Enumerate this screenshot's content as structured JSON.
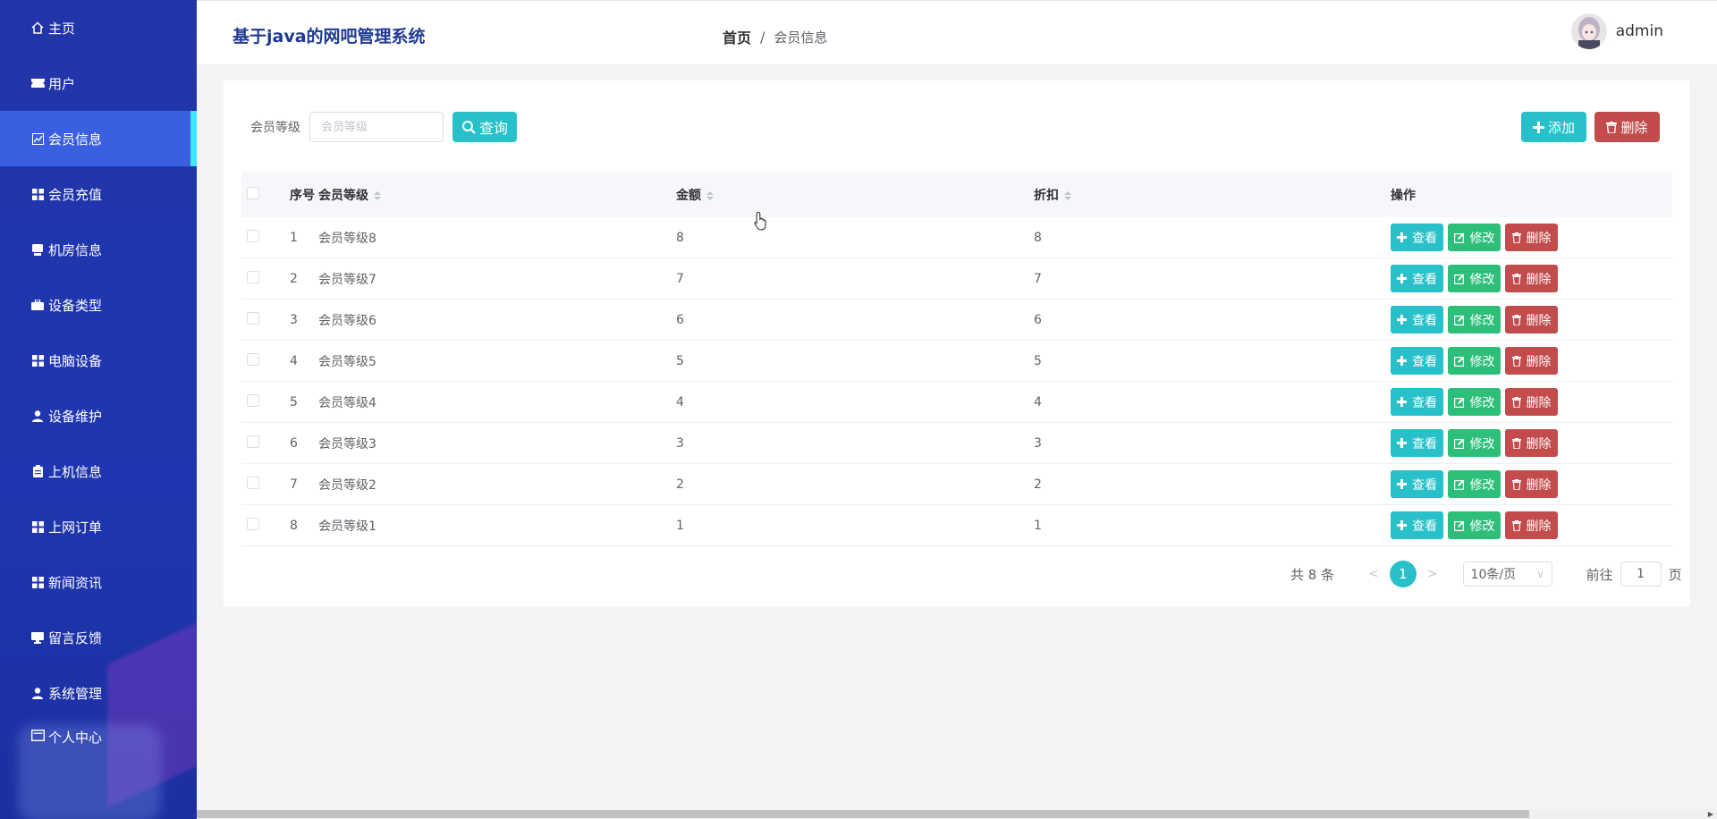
{
  "app": {
    "title": "基于java的网吧管理系统"
  },
  "sidebar": {
    "items": [
      {
        "label": "主页",
        "icon": "home-icon",
        "active": false
      },
      {
        "label": "用户",
        "icon": "ticket-icon",
        "active": false
      },
      {
        "label": "会员信息",
        "icon": "chart-icon",
        "active": true
      },
      {
        "label": "会员充值",
        "icon": "grid-icon",
        "active": false
      },
      {
        "label": "机房信息",
        "icon": "server-icon",
        "active": false
      },
      {
        "label": "设备类型",
        "icon": "briefcase-icon",
        "active": false
      },
      {
        "label": "电脑设备",
        "icon": "grid-icon",
        "active": false
      },
      {
        "label": "设备维护",
        "icon": "user-icon",
        "active": false
      },
      {
        "label": "上机信息",
        "icon": "clipboard-icon",
        "active": false
      },
      {
        "label": "上网订单",
        "icon": "grid-icon",
        "active": false
      },
      {
        "label": "新闻资讯",
        "icon": "grid-icon",
        "active": false
      },
      {
        "label": "留言反馈",
        "icon": "monitor-icon",
        "active": false
      },
      {
        "label": "系统管理",
        "icon": "user-icon",
        "active": false
      },
      {
        "label": "个人中心",
        "icon": "id-card-icon",
        "active": false
      }
    ]
  },
  "header": {
    "breadcrumb_home": "首页",
    "breadcrumb_sep": "/",
    "breadcrumb_current": "会员信息",
    "username": "admin"
  },
  "search": {
    "label": "会员等级",
    "placeholder": "会员等级",
    "value": "",
    "query_label": "查询"
  },
  "toolbar": {
    "add_label": "添加",
    "delete_label": "删除"
  },
  "table": {
    "columns": {
      "index": "序号",
      "level": "会员等级",
      "amount": "金额",
      "discount": "折扣",
      "ops": "操作"
    },
    "rows": [
      {
        "index": "1",
        "level": "会员等级8",
        "amount": "8",
        "discount": "8"
      },
      {
        "index": "2",
        "level": "会员等级7",
        "amount": "7",
        "discount": "7"
      },
      {
        "index": "3",
        "level": "会员等级6",
        "amount": "6",
        "discount": "6"
      },
      {
        "index": "4",
        "level": "会员等级5",
        "amount": "5",
        "discount": "5"
      },
      {
        "index": "5",
        "level": "会员等级4",
        "amount": "4",
        "discount": "4"
      },
      {
        "index": "6",
        "level": "会员等级3",
        "amount": "3",
        "discount": "3"
      },
      {
        "index": "7",
        "level": "会员等级2",
        "amount": "2",
        "discount": "2"
      },
      {
        "index": "8",
        "level": "会员等级1",
        "amount": "1",
        "discount": "1"
      }
    ],
    "row_ops": {
      "view": "查看",
      "edit": "修改",
      "delete": "删除"
    }
  },
  "pagination": {
    "total_text": "共 8 条",
    "prev": "<",
    "next": ">",
    "current_page": "1",
    "page_size": "10条/页",
    "goto_label": "前往",
    "goto_value": "1",
    "page_suffix": "页"
  },
  "colors": {
    "sidebar_bg": "#1f36b0",
    "sidebar_active": "#3a5fe0",
    "sidebar_active_marker": "#3de8ff",
    "primary": "#28c0c9",
    "success": "#2dbf7a",
    "danger": "#c24c4c",
    "title": "#1f3a93"
  }
}
